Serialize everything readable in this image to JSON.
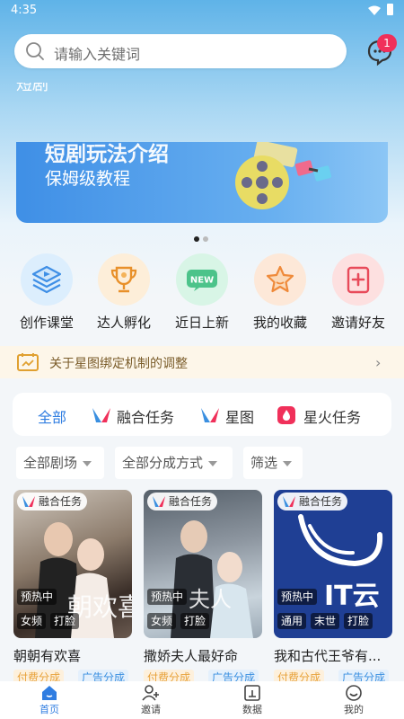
{
  "status": {
    "time": "4:35"
  },
  "search": {
    "placeholder": "请输入关键词",
    "badge": "1"
  },
  "banner": {
    "title": "短剧玩法介绍",
    "subtitle": "保姆级教程",
    "header_peek": "短剧"
  },
  "quick_entries": [
    {
      "label": "创作课堂",
      "icon": "layers-play-icon",
      "bg": "#dceefd"
    },
    {
      "label": "达人孵化",
      "icon": "trophy-icon",
      "bg": "#fdeed9"
    },
    {
      "label": "近日上新",
      "icon": "new-badge-icon",
      "bg": "#d8f5e6"
    },
    {
      "label": "我的收藏",
      "icon": "star-icon",
      "bg": "#fde8d8"
    },
    {
      "label": "邀请好友",
      "icon": "invite-icon",
      "bg": "#fde0e0"
    }
  ],
  "notice": {
    "text": "关于星图绑定机制的调整"
  },
  "tabs": [
    "全部",
    "融合任务",
    "星图",
    "星火任务"
  ],
  "filters": [
    "全部剧场",
    "全部分成方式",
    "筛选"
  ],
  "cards": [
    {
      "tag": "融合任务",
      "badge": "预热中",
      "chips": [
        "女频",
        "打脸"
      ],
      "title": "朝朝有欢喜",
      "subs": [
        "付费分成",
        "广告分成"
      ]
    },
    {
      "tag": "融合任务",
      "badge": "预热中",
      "chips": [
        "女频",
        "打脸"
      ],
      "title": "撒娇夫人最好命",
      "subs": [
        "付费分成",
        "广告分成"
      ]
    },
    {
      "tag": "融合任务",
      "badge": "预热中",
      "chips": [
        "通用",
        "末世",
        "打脸"
      ],
      "title": "我和古代王爷有...",
      "subs": [
        "付费分成",
        "广告分成"
      ]
    }
  ],
  "nav": [
    "首页",
    "邀请",
    "数据",
    "我的"
  ],
  "colors": {
    "accent": "#2f7de1",
    "badge": "#f0305a",
    "pay": "#e8a23a",
    "ad": "#3a8fe0"
  }
}
